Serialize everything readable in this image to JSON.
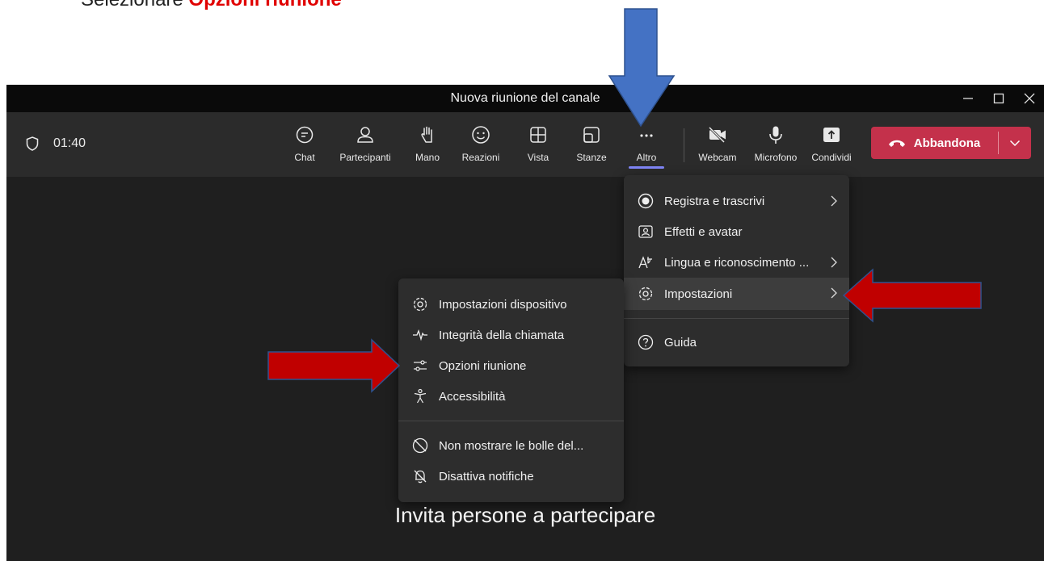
{
  "caption": {
    "prefix": "Selezionare ",
    "highlight": "Opzioni riunione"
  },
  "window": {
    "title": "Nuova riunione del canale"
  },
  "toolbar": {
    "timer": "01:40",
    "buttons": [
      {
        "label": "Chat",
        "icon": "chat-icon"
      },
      {
        "label": "Partecipanti",
        "icon": "people-icon"
      },
      {
        "label": "Mano",
        "icon": "raise-hand-icon"
      },
      {
        "label": "Reazioni",
        "icon": "smiley-icon"
      },
      {
        "label": "Vista",
        "icon": "grid-view-icon"
      },
      {
        "label": "Stanze",
        "icon": "rooms-icon"
      },
      {
        "label": "Altro",
        "icon": "more-icon"
      },
      {
        "label": "Webcam",
        "icon": "camera-off-icon"
      },
      {
        "label": "Microfono",
        "icon": "microphone-icon"
      },
      {
        "label": "Condividi",
        "icon": "share-icon"
      }
    ],
    "leave_label": "Abbandona"
  },
  "more_menu": {
    "items": [
      {
        "label": "Registra e trascrivi",
        "icon": "record-icon"
      },
      {
        "label": "Effetti e avatar",
        "icon": "effects-icon"
      },
      {
        "label": "Lingua e riconoscimento ...",
        "icon": "language-icon"
      },
      {
        "label": "Impostazioni",
        "icon": "gear-icon"
      },
      {
        "label": "Guida",
        "icon": "help-icon"
      }
    ]
  },
  "settings_menu": {
    "items": [
      {
        "label": "Impostazioni dispositivo",
        "icon": "gear-icon"
      },
      {
        "label": "Integrità della chiamata",
        "icon": "pulse-icon"
      },
      {
        "label": "Opzioni riunione",
        "icon": "sliders-icon"
      },
      {
        "label": "Accessibilità",
        "icon": "accessibility-icon"
      },
      {
        "label": "Non mostrare le bolle del...",
        "icon": "chat-off-icon"
      },
      {
        "label": "Disattiva notifiche",
        "icon": "bell-off-icon"
      }
    ]
  },
  "main": {
    "invite_text": "Invita persone a partecipare"
  },
  "colors": {
    "leave": "#c4314b",
    "accent": "#7f85f5",
    "annotation_red": "#c00000",
    "annotation_blue": "#4472c4"
  }
}
